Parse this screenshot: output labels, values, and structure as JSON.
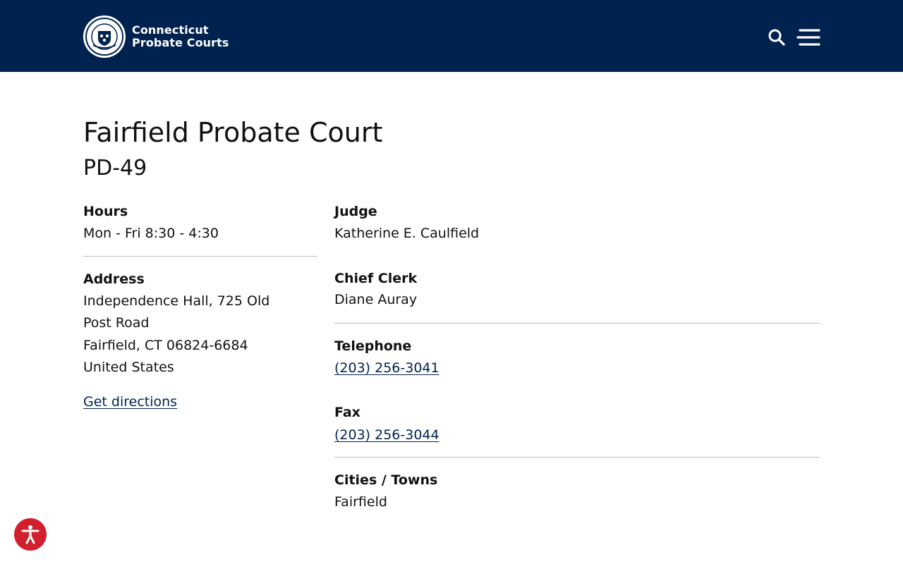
{
  "header": {
    "logo_icon": "connecticut-seal-logo",
    "site_title_line1": "Connecticut",
    "site_title_line2": "Probate Courts",
    "search_icon": "search-icon",
    "menu_icon": "hamburger-menu-icon",
    "background_color": "#00224f"
  },
  "court": {
    "name": "Fairfield Probate Court",
    "code": "PD-49"
  },
  "details": {
    "hours_label": "Hours",
    "hours_value": "Mon - Fri 8:30 - 4:30",
    "address_label": "Address",
    "address_line1": "Independence Hall, 725 Old",
    "address_line2": "Post Road",
    "address_line3": "Fairfield, CT 06824-6684",
    "address_line4": "United States",
    "directions_link": "Get directions",
    "judge_label": "Judge",
    "judge_value": "Katherine E. Caulfield",
    "chief_clerk_label": "Chief Clerk",
    "chief_clerk_value": "Diane Auray",
    "telephone_label": "Telephone",
    "telephone_value": "(203) 256-3041",
    "fax_label": "Fax",
    "fax_value": "(203) 256-3044",
    "cities_label": "Cities / Towns",
    "cities_value": "Fairfield"
  },
  "accessibility": {
    "icon": "accessibility-icon",
    "color": "#d11f2d"
  }
}
